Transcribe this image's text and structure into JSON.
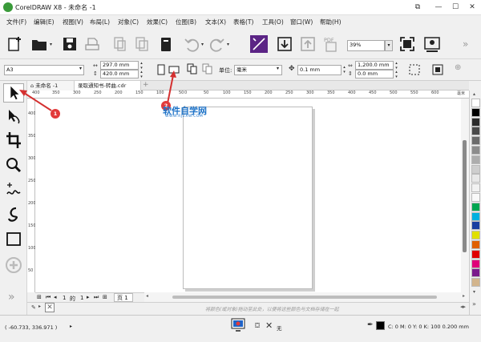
{
  "window": {
    "title": "CorelDRAW X8 - 未命名 -1"
  },
  "menu": [
    "文件(F)",
    "编辑(E)",
    "视图(V)",
    "布局(L)",
    "对象(C)",
    "效果(C)",
    "位图(B)",
    "文本(X)",
    "表格(T)",
    "工具(O)",
    "窗口(W)",
    "帮助(H)"
  ],
  "toolbar": {
    "zoom": "39%",
    "pdf_label": "PDF"
  },
  "propbar": {
    "page_size": "A3",
    "width": "297.0 mm",
    "height": "420.0 mm",
    "units_label": "单位:",
    "units": "毫米",
    "nudge": "0.1 mm",
    "dup_x": "1,200.0 mm",
    "dup_y": "0.0 mm"
  },
  "tabs": {
    "welcome": "未命名 -1",
    "doc": "录取通知书-转曲.cdr"
  },
  "ruler": {
    "h": [
      "400",
      "350",
      "300",
      "250",
      "200",
      "150",
      "100",
      "50",
      "0",
      "50",
      "100",
      "150",
      "200",
      "250",
      "300",
      "350",
      "400",
      "450",
      "500",
      "550",
      "600"
    ],
    "h_unit": "毫米",
    "v": [
      "400",
      "350",
      "300",
      "250",
      "200",
      "150",
      "100",
      "50"
    ]
  },
  "pagenav": {
    "current": "1",
    "of": "的",
    "total": "1",
    "page_tab": "页 1"
  },
  "hint": "将颜色(或对象)拖动至此处，以便将这些颜色与文档存储在一起",
  "status": {
    "coords": "( -60.733, 336.971 )",
    "fill_none": "无",
    "outline": "C: 0 M: 0 Y: 0 K: 100  0.200 mm"
  },
  "annotations": {
    "badge1": "1",
    "badge2": "2",
    "watermark": "软件自学网",
    "watermark_sub": "WWW.RJZXW.COM"
  },
  "palette_colors": [
    "#ffffff",
    "#000000",
    "#2b2b2b",
    "#4a4a4a",
    "#6b6b6b",
    "#8c8c8c",
    "#adadad",
    "#cecece",
    "#e8e8e8",
    "#f2f2f2",
    "#f9f9f9",
    "#00a650",
    "#00b0e0",
    "#1a3fa0",
    "#e0e000",
    "#e06000",
    "#e00000",
    "#e0007a",
    "#7a1a8c",
    "#d2b48c"
  ],
  "colors": {
    "accent": "#6a2a8c",
    "badge": "#e23a3a",
    "arrow": "#d43030",
    "watermark": "#1e73c8"
  }
}
